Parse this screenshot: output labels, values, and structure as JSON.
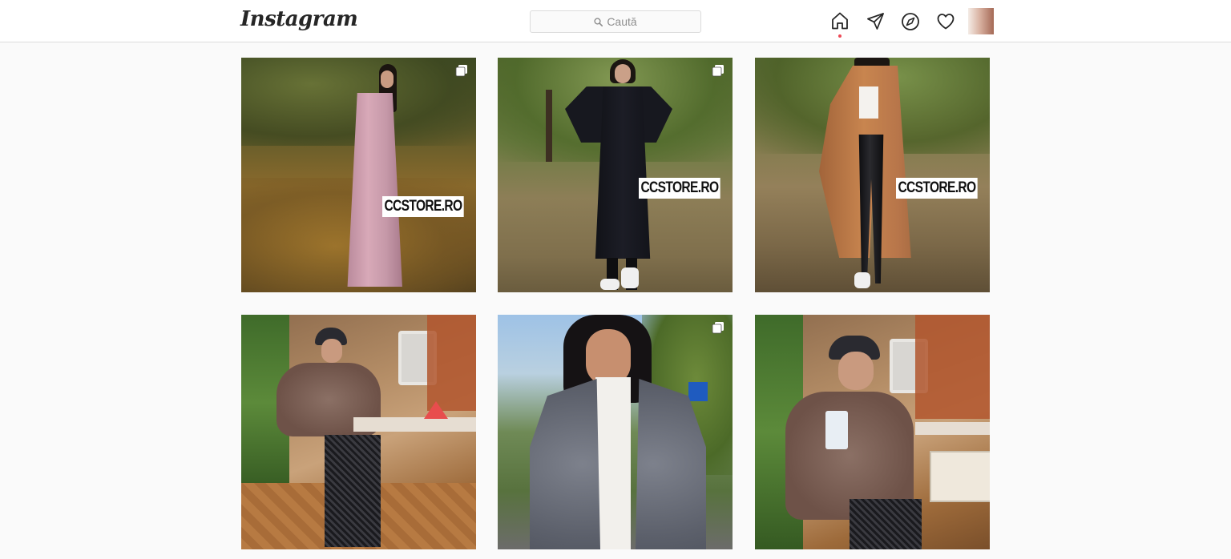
{
  "app": {
    "logo_text": "Instagram"
  },
  "search": {
    "placeholder": "Caută"
  },
  "nav": {
    "icons": [
      "home-icon",
      "direct-message-icon",
      "explore-icon",
      "activity-heart-icon",
      "profile-avatar"
    ],
    "active": "home",
    "active_indicator_color": "#ed4956"
  },
  "colors": {
    "background": "#fafafa",
    "topbar": "#ffffff",
    "border": "#dbdbdb",
    "icon": "#262626",
    "placeholder_text": "#8e8e8e"
  },
  "grid": {
    "posts": [
      {
        "watermark": "CCSTORE.RO",
        "multi": true,
        "subject": "pink coat in autumn park"
      },
      {
        "watermark": "CCSTORE.RO",
        "multi": true,
        "subject": "black coat in park"
      },
      {
        "watermark": "CCSTORE.RO",
        "multi": false,
        "subject": "camel coat in park"
      },
      {
        "watermark": "",
        "multi": false,
        "subject": "fur jacket in cafe"
      },
      {
        "watermark": "",
        "multi": true,
        "subject": "grey fur jacket outdoors"
      },
      {
        "watermark": "",
        "multi": false,
        "subject": "fur jacket with drink in cafe"
      }
    ]
  }
}
